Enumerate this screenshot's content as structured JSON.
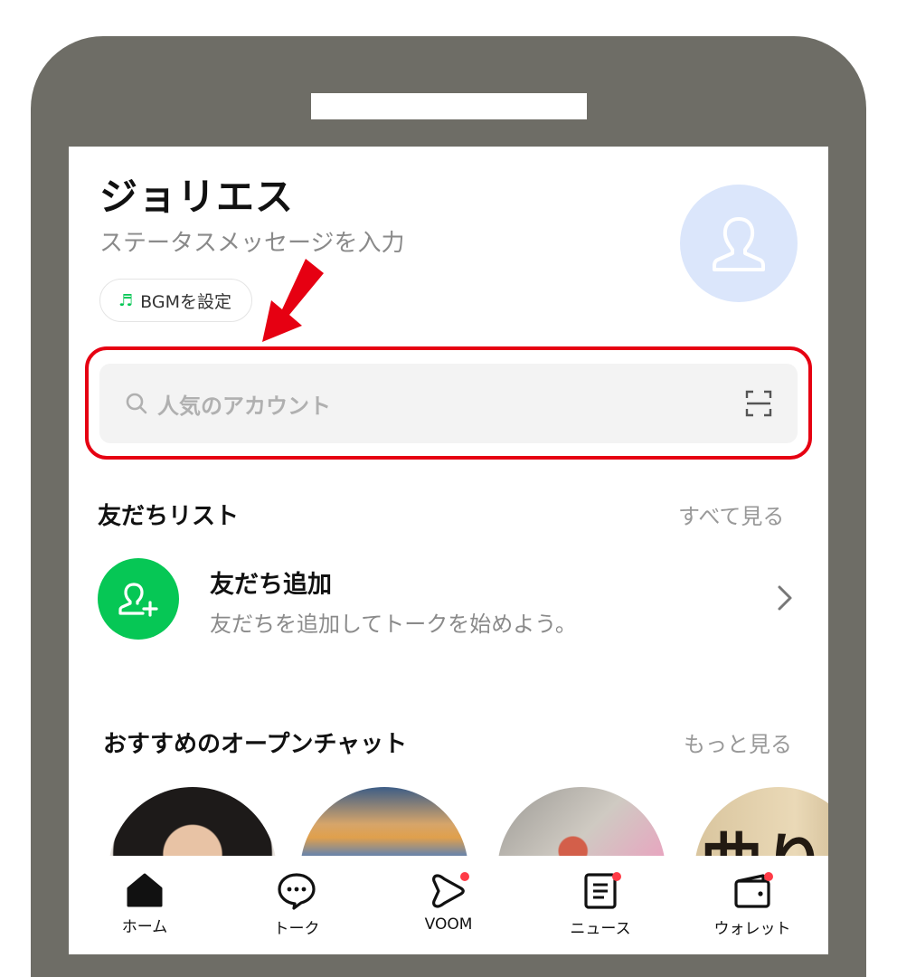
{
  "profile": {
    "name": "ジョリエス",
    "status_placeholder": "ステータスメッセージを入力",
    "bgm_label": "BGMを設定"
  },
  "search": {
    "placeholder": "人気のアカウント"
  },
  "friends": {
    "title": "友だちリスト",
    "see_all": "すべて見る",
    "add_title": "友だち追加",
    "add_subtitle": "友だちを追加してトークを始めよう。"
  },
  "openchat": {
    "title": "おすすめのオープンチャット",
    "more": "もっと見る",
    "thumb4_text": "曲り"
  },
  "tabbar": {
    "items": [
      {
        "label": "ホーム",
        "icon": "home-icon",
        "badge": false
      },
      {
        "label": "トーク",
        "icon": "chat-icon",
        "badge": false
      },
      {
        "label": "VOOM",
        "icon": "voom-icon",
        "badge": true
      },
      {
        "label": "ニュース",
        "icon": "news-icon",
        "badge": true
      },
      {
        "label": "ウォレット",
        "icon": "wallet-icon",
        "badge": true
      }
    ]
  },
  "colors": {
    "line_green": "#06c755",
    "highlight_red": "#e60012",
    "badge_red": "#ff3b47",
    "phone_frame": "#6e6d66"
  }
}
